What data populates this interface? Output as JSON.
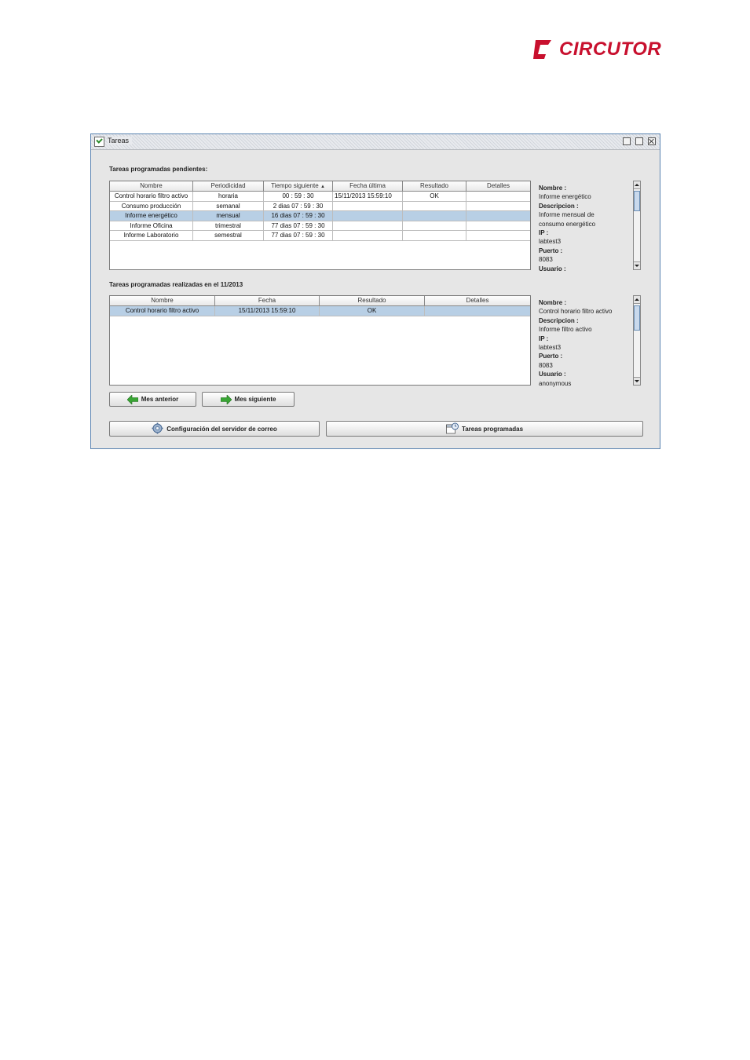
{
  "brand": {
    "name": "CIRCUTOR",
    "color": "#c8102e"
  },
  "window": {
    "title": "Tareas",
    "buttons": [
      "minimize",
      "maximize",
      "close"
    ]
  },
  "pending": {
    "section_label": "Tareas programadas pendientes:",
    "columns": [
      "Nombre",
      "Periodicidad",
      "Tiempo siguiente",
      "Fecha última",
      "Resultado",
      "Detalles"
    ],
    "sort_indicator": "▲",
    "rows": [
      {
        "nombre": "Control horario filtro activo",
        "periodicidad": "horaria",
        "tiempo": "00 : 59 : 30",
        "fecha": "15/11/2013   15:59:10",
        "resultado": "OK",
        "detalles": ""
      },
      {
        "nombre": "Consumo producción",
        "periodicidad": "semanal",
        "tiempo": "2 dias   07 : 59 : 30",
        "fecha": "",
        "resultado": "",
        "detalles": ""
      },
      {
        "nombre": "Informe energético",
        "periodicidad": "mensual",
        "tiempo": "16 dias   07 : 59 : 30",
        "fecha": "",
        "resultado": "",
        "detalles": ""
      },
      {
        "nombre": "Informe Oficina",
        "periodicidad": "trimestral",
        "tiempo": "77 dias   07 : 59 : 30",
        "fecha": "",
        "resultado": "",
        "detalles": ""
      },
      {
        "nombre": "Informe Laboratorio",
        "periodicidad": "semestral",
        "tiempo": "77 dias   07 : 59 : 30",
        "fecha": "",
        "resultado": "",
        "detalles": ""
      }
    ],
    "selected_row": 2,
    "details": {
      "nombre_label": "Nombre :",
      "nombre": "Informe energético",
      "descripcion_label": "Descripcion :",
      "descripcion_1": "Informe mensual de",
      "descripcion_2": "consumo energético",
      "ip_label": "IP :",
      "ip": "labtest3",
      "puerto_label": "Puerto :",
      "puerto": "8083",
      "usuario_label": "Usuario :"
    }
  },
  "done": {
    "section_label": "Tareas programadas realizadas en el 11/2013",
    "columns": [
      "Nombre",
      "Fecha",
      "Resultado",
      "Detalles"
    ],
    "rows": [
      {
        "nombre": "Control horario filtro activo",
        "fecha": "15/11/2013   15:59:10",
        "resultado": "OK",
        "detalles": ""
      }
    ],
    "selected_row": 0,
    "details": {
      "nombre_label": "Nombre :",
      "nombre": "Control horario filtro activo",
      "descripcion_label": "Descripcion :",
      "descripcion": "Informe filtro activo",
      "ip_label": "IP :",
      "ip": "labtest3",
      "puerto_label": "Puerto :",
      "puerto": "8083",
      "usuario_label": "Usuario :",
      "usuario": "anonymous"
    }
  },
  "nav": {
    "prev": "Mes anterior",
    "next": "Mes siguiente",
    "arrow_color": "#3aa535"
  },
  "actions": {
    "mail_config": "Configuración del servidor de correo",
    "scheduled": "Tareas programadas"
  },
  "colors": {
    "selection": "#b8cfe5",
    "window_border": "#5b84b1"
  }
}
